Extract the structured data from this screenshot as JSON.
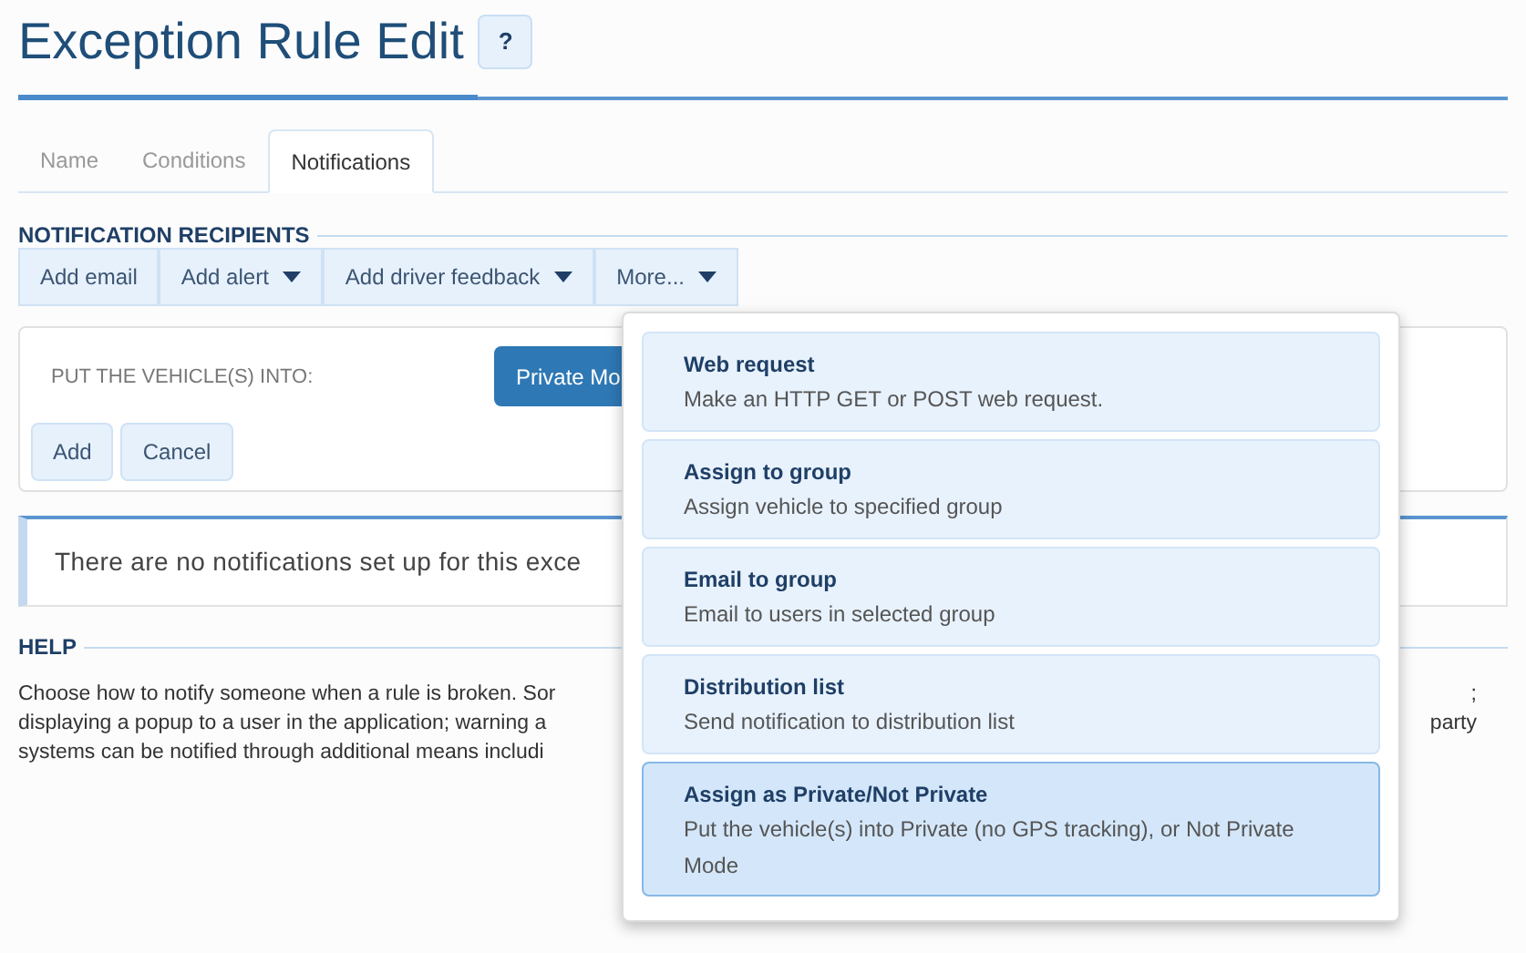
{
  "title": "Exception Rule Edit",
  "help_button": "?",
  "tabs": [
    {
      "label": "Name",
      "selected": false
    },
    {
      "label": "Conditions",
      "selected": false
    },
    {
      "label": "Notifications",
      "selected": true
    }
  ],
  "recipients": {
    "heading": "NOTIFICATION RECIPIENTS",
    "buttons": [
      {
        "label": "Add email",
        "has_menu": false
      },
      {
        "label": "Add alert",
        "has_menu": true
      },
      {
        "label": "Add driver feedback",
        "has_menu": true
      },
      {
        "label": "More...",
        "has_menu": true
      }
    ]
  },
  "form": {
    "label": "PUT THE VEHICLE(S) INTO:",
    "mode_button": "Private Mo",
    "buttons": [
      "Add",
      "Cancel"
    ]
  },
  "alert": "There are no notifications set up for this exce",
  "help": {
    "heading": "HELP",
    "lines": [
      {
        "left": "Choose how to notify someone when a rule is broken. Sor",
        "right": ";"
      },
      {
        "left": "displaying a popup to a user in the application; warning a",
        "right": "party"
      },
      {
        "left": "systems can be notified through additional means includi"
      }
    ]
  },
  "menu": [
    {
      "title": "Web request",
      "description": "Make an HTTP GET or POST web request.",
      "selected": false
    },
    {
      "title": "Assign to group",
      "description": "Assign vehicle to specified group",
      "selected": false
    },
    {
      "title": "Email to group",
      "description": "Email to users in selected group",
      "selected": false
    },
    {
      "title": "Distribution list",
      "description": "Send notification to distribution list",
      "selected": false
    },
    {
      "title": "Assign as Private/Not Private",
      "description": "Put the vehicle(s) into Private (no GPS tracking), or Not Private Mode",
      "selected": true
    }
  ]
}
